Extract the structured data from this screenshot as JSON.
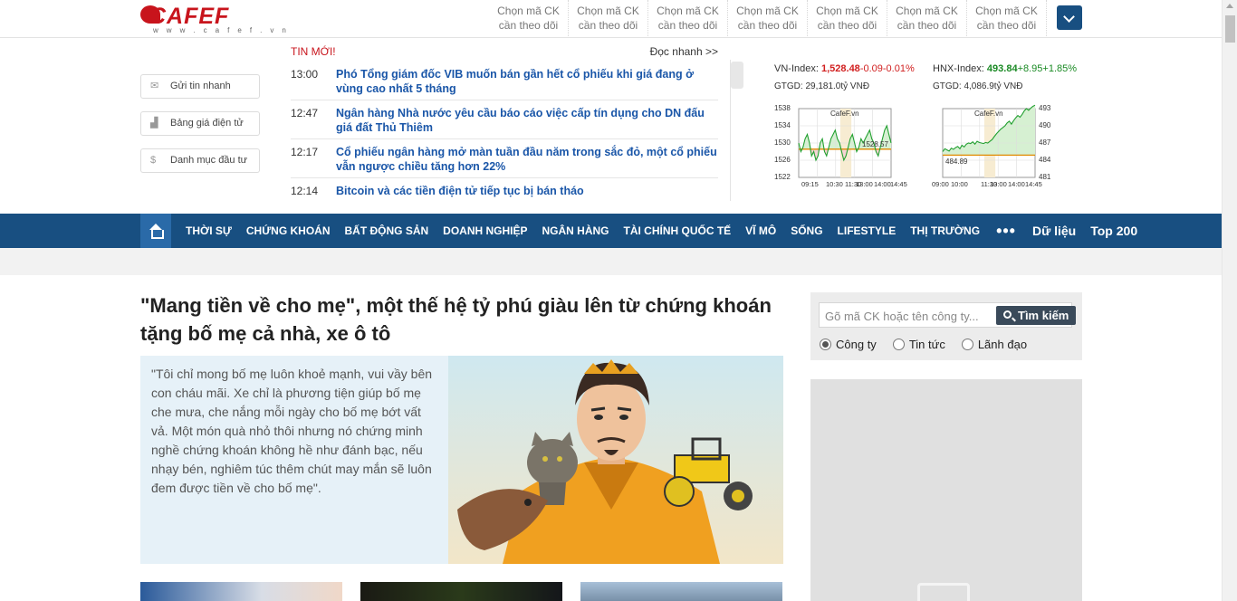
{
  "header": {
    "logo_text": "CAFEF",
    "logo_url": "w w w . c a f e f . v n",
    "watch_slots": [
      {
        "line1": "Chọn mã CK",
        "line2": "cần theo dõi"
      },
      {
        "line1": "Chọn mã CK",
        "line2": "cần theo dõi"
      },
      {
        "line1": "Chọn mã CK",
        "line2": "cần theo dõi"
      },
      {
        "line1": "Chọn mã CK",
        "line2": "cần theo dõi"
      },
      {
        "line1": "Chọn mã CK",
        "line2": "cần theo dõi"
      },
      {
        "line1": "Chọn mã CK",
        "line2": "cần theo dõi"
      },
      {
        "line1": "Chọn mã CK",
        "line2": "cần theo dõi"
      }
    ]
  },
  "quick_links": [
    {
      "label": "Gửi tin nhanh",
      "icon": "envelope-icon"
    },
    {
      "label": "Bảng giá điện tử",
      "icon": "chart-icon"
    },
    {
      "label": "Danh mục đầu tư",
      "icon": "dollar-icon"
    }
  ],
  "ticker": {
    "label": "TIN MỚI!",
    "more": "Đọc nhanh >>",
    "items": [
      {
        "time": "13:00",
        "title": "Phó Tổng giám đốc VIB muốn bán gần hết cổ phiếu khi giá đang ở vùng cao nhất 5 tháng"
      },
      {
        "time": "12:47",
        "title": "Ngân hàng Nhà nước yêu cầu báo cáo việc cấp tín dụng cho DN đấu giá đất Thủ Thiêm"
      },
      {
        "time": "12:17",
        "title": "Cổ phiếu ngân hàng mở màn tuần đầu năm trong sắc đỏ, một cổ phiếu vẫn ngược chiều tăng hơn 22%"
      },
      {
        "time": "12:14",
        "title": "Bitcoin và các tiền điện tử tiếp tục bị bán tháo"
      }
    ]
  },
  "markets": [
    {
      "name": "VN-Index:",
      "value": "1,528.48",
      "change": "-0.09-0.01%",
      "trend": "down",
      "volume": "GTGD: 29,181.0tỷ VNĐ",
      "chart_watermark": "CafeF.vn",
      "chart_marker": "1528.57",
      "y_ticks": [
        "1538",
        "1534",
        "1530",
        "1526",
        "1522"
      ],
      "x_ticks": [
        "09:15",
        "10:30",
        "11:30",
        "13:00",
        "14:00",
        "14:45"
      ],
      "reference": 1528.57,
      "ylim": [
        1522,
        1538
      ],
      "series": [
        1530,
        1528,
        1529,
        1531,
        1532,
        1530,
        1527,
        1528,
        1526,
        1527,
        1530,
        1531,
        1528,
        1527,
        1529,
        1531,
        1532,
        1533,
        1531,
        1530,
        1528,
        1526,
        1527,
        1529,
        1531,
        1532,
        1530,
        1528,
        1529,
        1531,
        1530,
        1531,
        1532,
        1533,
        1531,
        1530,
        1528,
        1527,
        1529,
        1531,
        1533,
        1534,
        1532,
        1530
      ]
    },
    {
      "name": "HNX-Index:",
      "value": "493.84",
      "change": "+8.95+1.85%",
      "trend": "up",
      "volume": "GTGD: 4,086.9tỷ VNĐ",
      "chart_watermark": "CafeF.vn",
      "chart_marker": "484.89",
      "y_ticks": [
        "493",
        "490",
        "487",
        "484",
        "481"
      ],
      "x_ticks": [
        "09:00",
        "10:00",
        "11:30",
        "13:00",
        "14:00",
        "14:45"
      ],
      "reference": 484.89,
      "ylim": [
        481,
        493
      ],
      "series": [
        485.5,
        486,
        485.8,
        485.6,
        486.1,
        485.9,
        486.2,
        486.4,
        486.0,
        486.6,
        486.3,
        486.8,
        487.0,
        486.9,
        487.2,
        486.8,
        487.3,
        487.1,
        487.0,
        486.9,
        487.1,
        487.0,
        487.3,
        487.6,
        488.1,
        488.6,
        489.0,
        489.4,
        489.7,
        490.0,
        490.5,
        490.8,
        490.3,
        490.9,
        491.4,
        491.8,
        491.5,
        492.0,
        492.6,
        493.0,
        492.7,
        493.1,
        493.4,
        493.6
      ]
    }
  ],
  "nav": {
    "items": [
      "THỜI SỰ",
      "CHỨNG KHOÁN",
      "BẤT ĐỘNG SẢN",
      "DOANH NGHIỆP",
      "NGÂN HÀNG",
      "TÀI CHÍNH QUỐC TẾ",
      "VĨ MÔ",
      "SỐNG",
      "LIFESTYLE",
      "THỊ TRƯỜNG"
    ],
    "dots": "•••",
    "extra": [
      "Dữ liệu",
      "Top 200"
    ]
  },
  "article": {
    "headline": "\"Mang tiền về cho mẹ\", một thế hệ tỷ phú giàu lên từ chứng khoán tặng bố mẹ cả nhà, xe ô tô",
    "quote": "\"Tôi chỉ mong bố mẹ luôn khoẻ mạnh, vui vầy bên con cháu mãi. Xe chỉ là phương tiện giúp bố mẹ che mưa, che nắng mỗi ngày cho bố mẹ bớt vất vả. Một món quà nhỏ thôi nhưng nó chứng minh nghề chứng khoán không hề như đánh bạc, nếu nhạy bén, nghiêm túc thêm chút may mắn sẽ luôn đem được tiền về cho bố mẹ\"."
  },
  "search": {
    "placeholder": "Gõ mã CK hoặc tên công ty...",
    "button": "Tìm kiếm",
    "options": [
      {
        "label": "Công ty",
        "checked": true
      },
      {
        "label": "Tin tức",
        "checked": false
      },
      {
        "label": "Lãnh đạo",
        "checked": false
      }
    ]
  },
  "colors": {
    "brand_red": "#c8141c",
    "nav_blue": "#184f81",
    "link_blue": "#1a56a8",
    "down_red": "#d12020",
    "up_green": "#1a8a24"
  }
}
